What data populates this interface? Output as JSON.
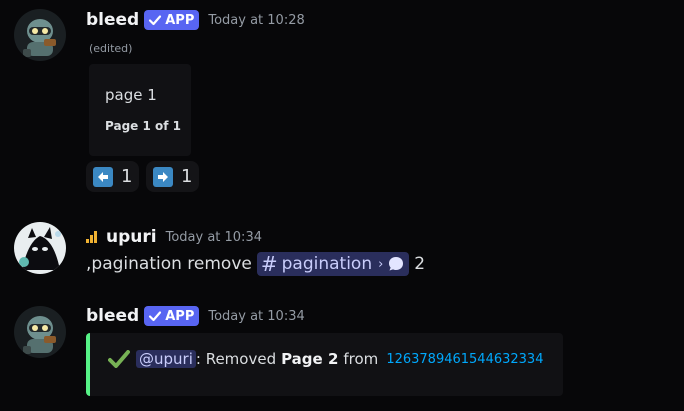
{
  "messages": [
    {
      "username": "bleed",
      "badge": "APP",
      "timestamp": "Today at 10:28",
      "edited": "(edited)",
      "embed": {
        "description": "page 1",
        "footer": "Page 1 of 1"
      },
      "reactions": [
        {
          "emoji": "left-arrow",
          "count": "1"
        },
        {
          "emoji": "right-arrow",
          "count": "1"
        }
      ]
    },
    {
      "username": "upuri",
      "timestamp": "Today at 10:34",
      "content_prefix": ",pagination remove",
      "channel_mention": "pagination",
      "trailing": "2"
    },
    {
      "username": "bleed",
      "badge": "APP",
      "timestamp": "Today at 10:34",
      "embed": {
        "mention": "@upuri",
        "text_a": ": Removed",
        "bold": "Page 2",
        "text_b": "from",
        "link": "1263789461544632334",
        "accent": "#57f287"
      }
    }
  ],
  "colors": {
    "background": "#070709",
    "brand": "#5865f2",
    "link": "#00a8fc",
    "success": "#57f287"
  }
}
